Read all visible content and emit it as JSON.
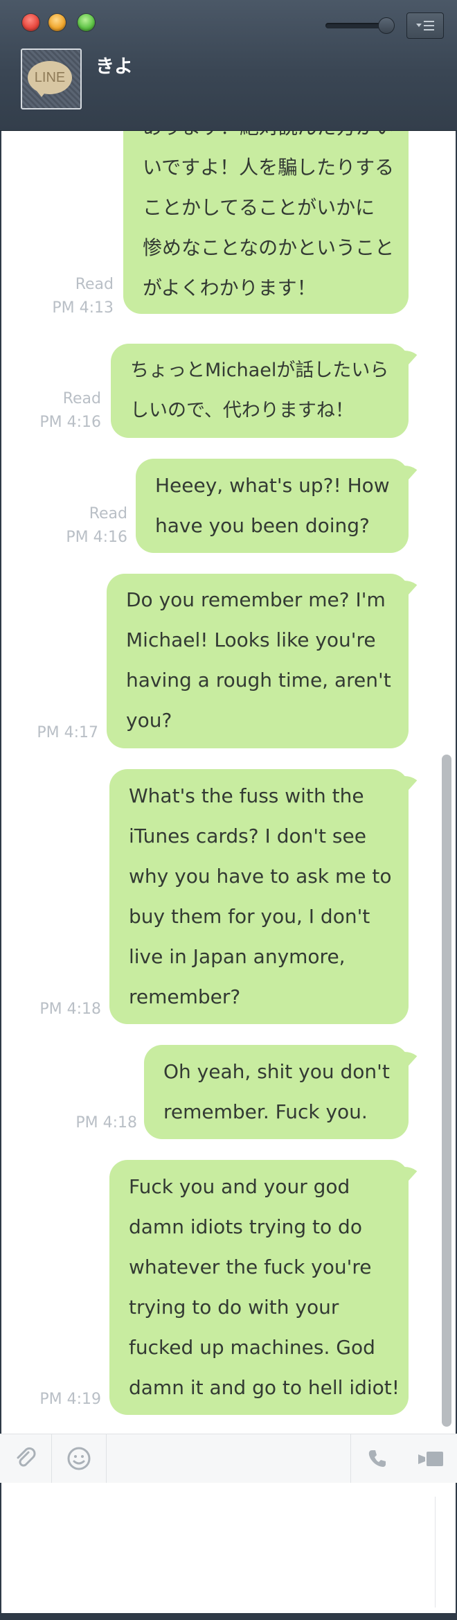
{
  "window": {
    "menu_icon": "menu-lines-icon"
  },
  "contact": {
    "name": "きよ",
    "avatar_text": "LINE"
  },
  "messages": [
    {
      "status": "Read",
      "time": "PM 4:13",
      "lines": [
        "あります？絶対読んだ方がい",
        "いですよ！人を騙したりする",
        "ことかしてることがいかに",
        "惨めなことなのかということ",
        "がよくわかります！"
      ]
    },
    {
      "status": "Read",
      "time": "PM 4:16",
      "lines": [
        "ちょっとMichaelが話したいら",
        "しいので、代わりますね！"
      ]
    },
    {
      "status": "Read",
      "time": "PM 4:16",
      "lines": [
        "Heeey, what's up?! How",
        "have you been doing?"
      ]
    },
    {
      "status": "",
      "time": "PM 4:17",
      "lines": [
        "Do you remember me? I'm",
        "Michael! Looks like you're",
        "having a rough time, aren't",
        "you?"
      ]
    },
    {
      "status": "",
      "time": "PM 4:18",
      "lines": [
        "What's the fuss with the",
        "iTunes cards? I don't see",
        "why you have to ask me to",
        "buy them for you, I don't",
        "live in Japan anymore,",
        "remember?"
      ]
    },
    {
      "status": "",
      "time": "PM 4:18",
      "lines": [
        "Oh yeah, shit you don't",
        "remember. Fuck you."
      ]
    },
    {
      "status": "",
      "time": "PM 4:19",
      "lines": [
        "Fuck you and your god",
        "damn idiots trying to do",
        "whatever the fuck you're",
        "trying to do with your",
        "fucked up machines. God",
        "damn it and go to hell idiot!"
      ]
    }
  ],
  "toolbar": {
    "attach_icon": "paperclip-icon",
    "emoji_icon": "smiley-icon",
    "call_icon": "phone-icon",
    "video_icon": "video-camera-icon"
  },
  "composer": {
    "value": "",
    "placeholder": ""
  },
  "colors": {
    "bubble": "#c8eca0",
    "titlebar": "#3a4654",
    "timestamp": "#b9bfc6"
  }
}
